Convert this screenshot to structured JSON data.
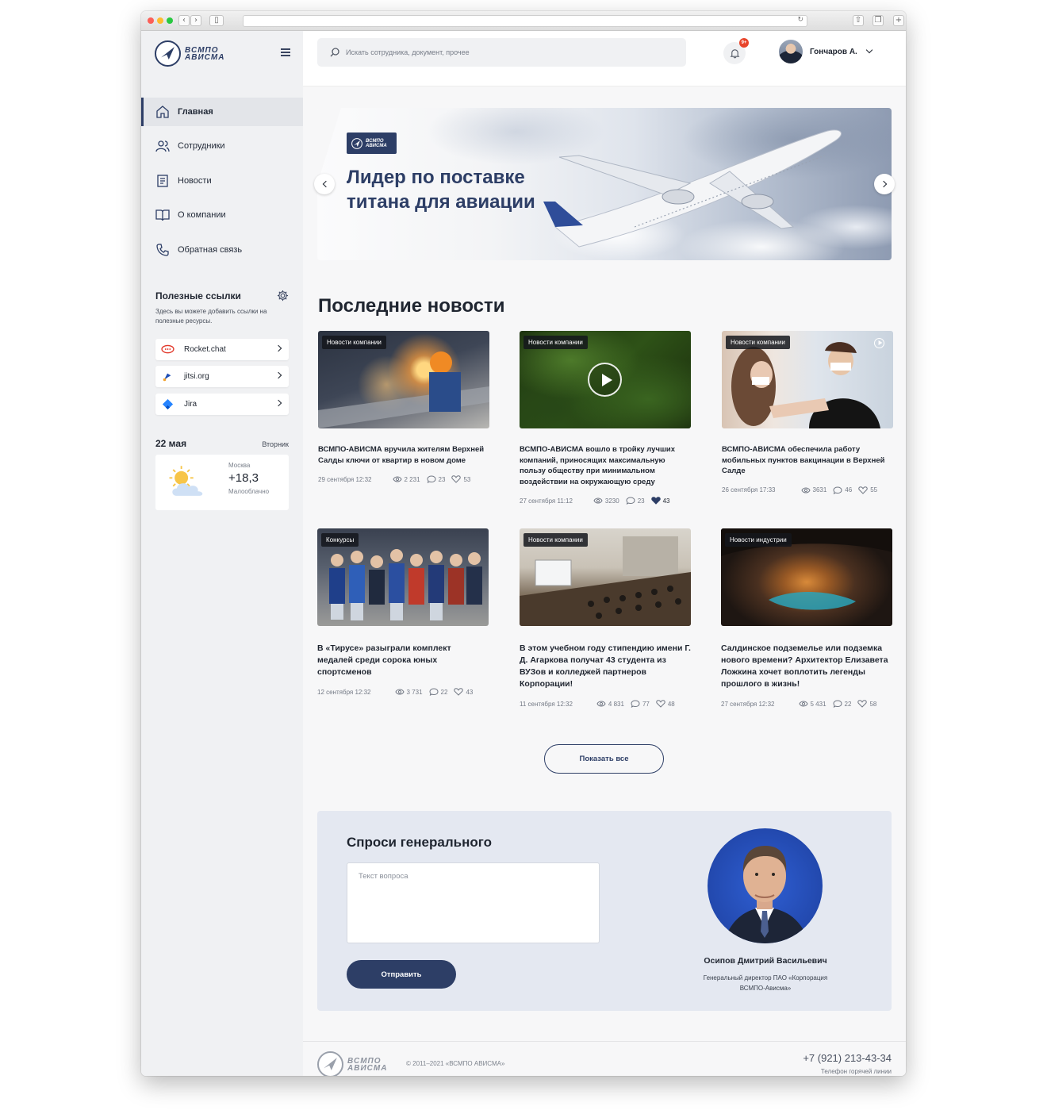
{
  "brand": {
    "logo_line1": "ВСМПО",
    "logo_line2": "АВИСМА",
    "accent": "#2d3e66"
  },
  "search": {
    "placeholder": "Искать сотрудника, документ, прочее"
  },
  "notifications": {
    "badge": "9+"
  },
  "user": {
    "name": "Гончаров А."
  },
  "nav": [
    {
      "label": "Главная",
      "icon": "home-icon",
      "active": true
    },
    {
      "label": "Сотрудники",
      "icon": "users-icon"
    },
    {
      "label": "Новости",
      "icon": "news-icon"
    },
    {
      "label": "О компании",
      "icon": "book-icon"
    },
    {
      "label": "Обратная связь",
      "icon": "phone-icon"
    }
  ],
  "links": {
    "title": "Полезные ссылки",
    "description": "Здесь вы можете добавить ссылки на полезные ресурсы.",
    "items": [
      {
        "label": "Rocket.chat",
        "icon": "rocket-chat-icon"
      },
      {
        "label": "jitsi.org",
        "icon": "jitsi-icon"
      },
      {
        "label": "Jira",
        "icon": "jira-icon"
      }
    ]
  },
  "date": {
    "day": "22 мая",
    "weekday": "Вторник"
  },
  "weather": {
    "city": "Москва",
    "temp": "+18,3",
    "desc": "Малооблачно",
    "icon": "partly-cloudy-icon"
  },
  "banner": {
    "title": "Лидер по поставке титана для авиации"
  },
  "news": {
    "title": "Последние новости",
    "items": [
      {
        "tag": "Новости компании",
        "title": "ВСМПО-АВИСМА вручила жителям Верхней Салды ключи от квартир в новом доме",
        "date": "29 сентября 12:32",
        "views": "2 231",
        "comments": "23",
        "likes": "53",
        "liked": false
      },
      {
        "tag": "Новости компании",
        "title": "ВСМПО-АВИСМА вошло в тройку лучших компаний, приносящих максимальную пользу обществу при минимальном воздействии на окружающую среду",
        "date": "27 сентября 11:12",
        "views": "3230",
        "comments": "23",
        "likes": "43",
        "liked": true
      },
      {
        "tag": "Новости компании",
        "title": "ВСМПО-АВИСМА обеспечила работу мобильных пунктов вакцинации в Верхней Салде",
        "date": "26 сентября 17:33",
        "views": "3631",
        "comments": "46",
        "likes": "55",
        "liked": false
      },
      {
        "tag": "Конкурсы",
        "title": "В «Тирусе» разыграли комплект медалей среди сорока юных спортсменов",
        "date": "12 сентября 12:32",
        "views": "3 731",
        "comments": "22",
        "likes": "43",
        "liked": false
      },
      {
        "tag": "Новости компании",
        "title": "В этом учебном году стипендию имени Г. Д. Агаркова получат 43 студента из ВУЗов и колледжей партнеров Корпорации!",
        "date": "11 сентября 12:32",
        "views": "4 831",
        "comments": "77",
        "likes": "48",
        "liked": false
      },
      {
        "tag": "Новости индустрии",
        "title": "Салдинское подземелье или подземка нового времени? Архитектор Елизавета Ложкина хочет воплотить легенды прошлого в жизнь!",
        "date": "27 сентября 12:32",
        "views": "5 431",
        "comments": "22",
        "likes": "58",
        "liked": false
      }
    ],
    "show_all": "Показать все"
  },
  "ask": {
    "title": "Спроси генерального",
    "placeholder": "Текст вопроса",
    "send": "Отправить",
    "ceo_name": "Осипов Дмитрий Васильевич",
    "ceo_role": "Генеральный директор ПАО «Корпорация ВСМПО-Ависма»"
  },
  "footer": {
    "copyright": "© 2011–2021 «ВСМПО АВИСМА»",
    "phone": "+7 (921) 213-43-34",
    "phone_label": "Телефон горячей линии"
  }
}
